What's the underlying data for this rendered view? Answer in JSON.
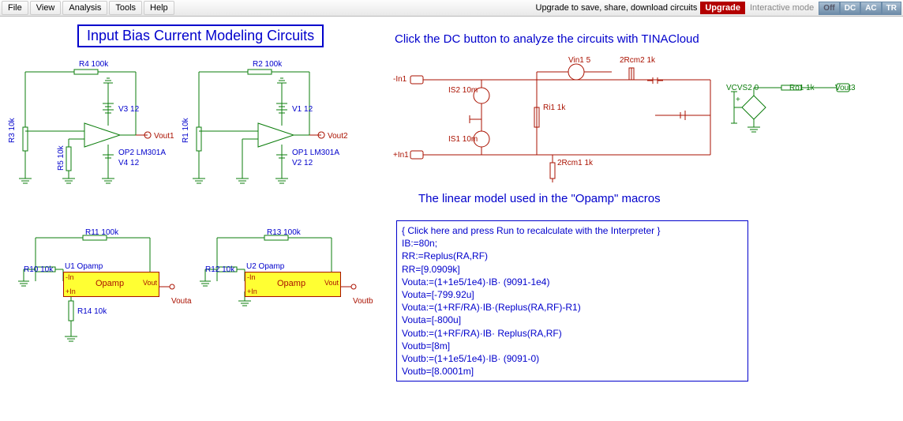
{
  "menu": {
    "file": "File",
    "view": "View",
    "analysis": "Analysis",
    "tools": "Tools",
    "help": "Help"
  },
  "header": {
    "upgrade_text": "Upgrade to save, share, download circuits",
    "upgrade_btn": "Upgrade",
    "mode_label": "Interactive mode",
    "modes": {
      "off": "Off",
      "dc": "DC",
      "ac": "AC",
      "tr": "TR"
    }
  },
  "title": "Input Bias Current Modeling Circuits",
  "hint_dc": "Click the DC button to analyze the circuits with TINACloud",
  "hint_linear": "The linear model used in the \"Opamp\" macros",
  "circuit_left": {
    "r4": "R4 100k",
    "r3": "R3 10k",
    "r5": "R5 10k",
    "v3": "V3 12",
    "v4": "V4 12",
    "op": "OP2 LM301A",
    "vout": "Vout1"
  },
  "circuit_mid": {
    "r2": "R2 100k",
    "r1": "R1 10k",
    "v1": "V1 12",
    "v2": "V2 12",
    "op": "OP1 LM301A",
    "vout": "Vout2"
  },
  "circuit_right": {
    "in_neg": "-In1",
    "in_pos": "+In1",
    "is2": "IS2 10m",
    "is1": "IS1 10m",
    "vin": "Vin1 5",
    "rcm2": "2Rcm2 1k",
    "rcm1": "2Rcm1 1k",
    "ri1": "Ri1 1k",
    "vcvs": "VCVS2 0",
    "ro1": "Ro1 1k",
    "vout": "Vout3"
  },
  "macro_a": {
    "r11": "R11 100k",
    "r10": "R10 10k",
    "r14": "R14 10k",
    "u": "U1 Opamp",
    "block": "Opamp",
    "vout": "Vouta",
    "in_lbl": "-In",
    "inp_lbl": "+In",
    "out_lbl": "Vout"
  },
  "macro_b": {
    "r13": "R13 100k",
    "r12": "R12 10k",
    "u": "U2 Opamp",
    "block": "Opamp",
    "vout": "Voutb",
    "in_lbl": "-In",
    "inp_lbl": "+In",
    "out_lbl": "Vout"
  },
  "interp": {
    "l1": "{ Click here and press Run to recalculate with the Interpreter }",
    "l2": "IB:=80n;",
    "l3": "",
    "l4": "RR:=Replus(RA,RF)",
    "l5": "RR=[9.0909k]",
    "l6": "",
    "l7": "Vouta:=(1+1e5/1e4)·IB· (9091-1e4)",
    "l8": "Vouta=[-799.92u]",
    "l9": "",
    "l10": "Vouta:=(1+RF/RA)·IB·(Replus(RA,RF)-R1)",
    "l11": "Vouta=[-800u]",
    "l12": "",
    "l13": "Voutb:=(1+RF/RA)·IB· Replus(RA,RF)",
    "l14": "Voutb=[8m]",
    "l15": "",
    "l16": "Voutb:=(1+1e5/1e4)·IB· (9091-0)",
    "l17": "Voutb=[8.0001m]"
  }
}
